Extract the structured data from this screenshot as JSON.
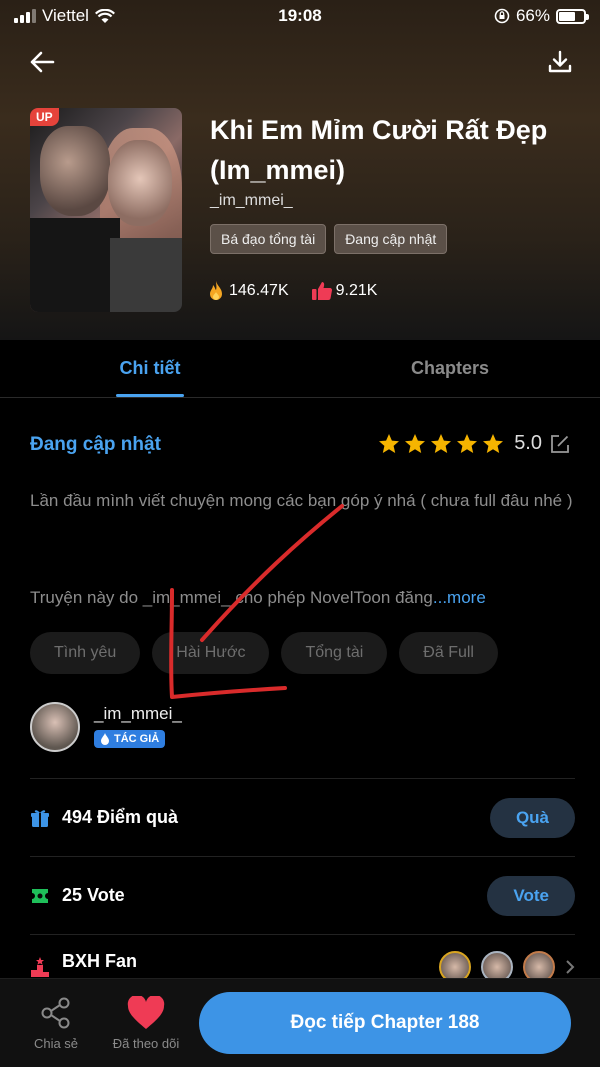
{
  "status_bar": {
    "carrier": "Viettel",
    "time": "19:08",
    "battery": "66%",
    "battery_level": 0.66
  },
  "book": {
    "up_badge": "UP",
    "title": "Khi Em Mỉm Cười Rất Đẹp (Im_mmei)",
    "author": "_im_mmei_",
    "tags": [
      "Bá đạo tổng tài",
      "Đang cập nhật"
    ],
    "views": "146.47K",
    "likes": "9.21K"
  },
  "tabs": [
    {
      "label": "Chi tiết",
      "active": true
    },
    {
      "label": "Chapters",
      "active": false
    }
  ],
  "details": {
    "status": "Đang cập nhật",
    "rating": "5.0",
    "stars": 5,
    "description": "Lần đầu mình viết chuyện  mong các bạn góp ý nhá ( chưa full đâu nhé )",
    "copyright_text": "Truyện này do _im_mmei_ cho phép NovelToon đăng",
    "more_label": "...more",
    "genres": [
      "Tình yêu",
      "Hài Hước",
      "Tổng tài",
      "Đã Full"
    ]
  },
  "author_block": {
    "name": "_im_mmei_",
    "badge": "TÁC GIẢ"
  },
  "gift_row": {
    "label": "494 Điểm quà",
    "button": "Quà"
  },
  "vote_row": {
    "label": "25 Vote",
    "button": "Vote"
  },
  "fan_row": {
    "label": "BXH Fan"
  },
  "bottom_bar": {
    "share_label": "Chia sẻ",
    "follow_label": "Đã theo dõi",
    "read_button": "Đọc tiếp Chapter 188"
  },
  "colors": {
    "accent": "#4aa3f0",
    "heart": "#ef3b55",
    "star": "#f5b400",
    "annotation": "#d92b2b"
  }
}
